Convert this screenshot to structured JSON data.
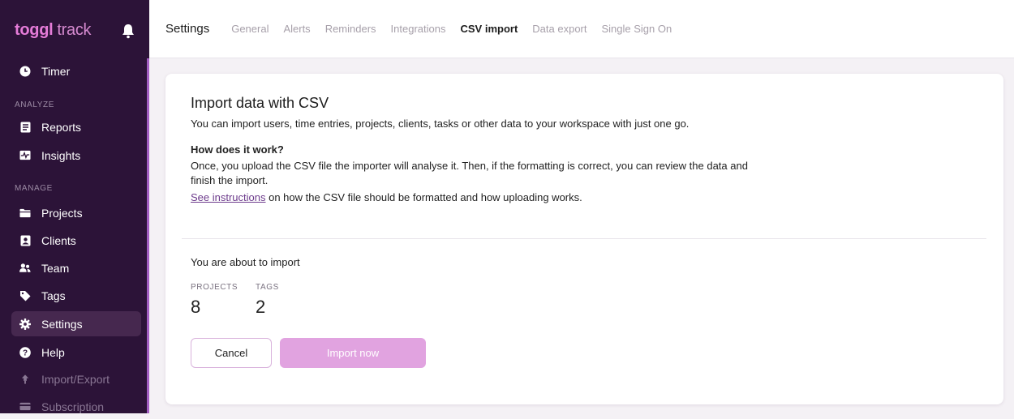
{
  "brand": {
    "logo_bold": "toggl",
    "logo_light": "track"
  },
  "sidebar": {
    "timer": "Timer",
    "analyze_label": "ANALYZE",
    "reports": "Reports",
    "insights": "Insights",
    "manage_label": "MANAGE",
    "projects": "Projects",
    "clients": "Clients",
    "team": "Team",
    "tags": "Tags",
    "settings": "Settings",
    "help": "Help",
    "import_export": "Import/Export",
    "subscription": "Subscription"
  },
  "topbar": {
    "title": "Settings",
    "tabs": [
      "General",
      "Alerts",
      "Reminders",
      "Integrations",
      "CSV import",
      "Data export",
      "Single Sign On"
    ],
    "active_tab": "CSV import"
  },
  "card": {
    "title": "Import data with CSV",
    "intro": "You can import users, time entries, projects, clients, tasks or other data to your workspace with just one go.",
    "how_title": "How does it work?",
    "how_text": "Once, you upload the CSV file the importer will analyse it. Then, if the formatting is correct, you can review the data and finish the import.",
    "link_text": "See instructions",
    "link_rest": " on how the CSV file should be formatted and how uploading works.",
    "about_text": "You are about to import",
    "stats": [
      {
        "label": "PROJECTS",
        "value": "8"
      },
      {
        "label": "TAGS",
        "value": "2"
      }
    ],
    "cancel_label": "Cancel",
    "import_label": "Import now"
  },
  "colors": {
    "sidebar_bg": "#2c1338",
    "brand_pink": "#e57cd8",
    "primary_button": "#e1a3e0",
    "link": "#6d3b8c"
  }
}
